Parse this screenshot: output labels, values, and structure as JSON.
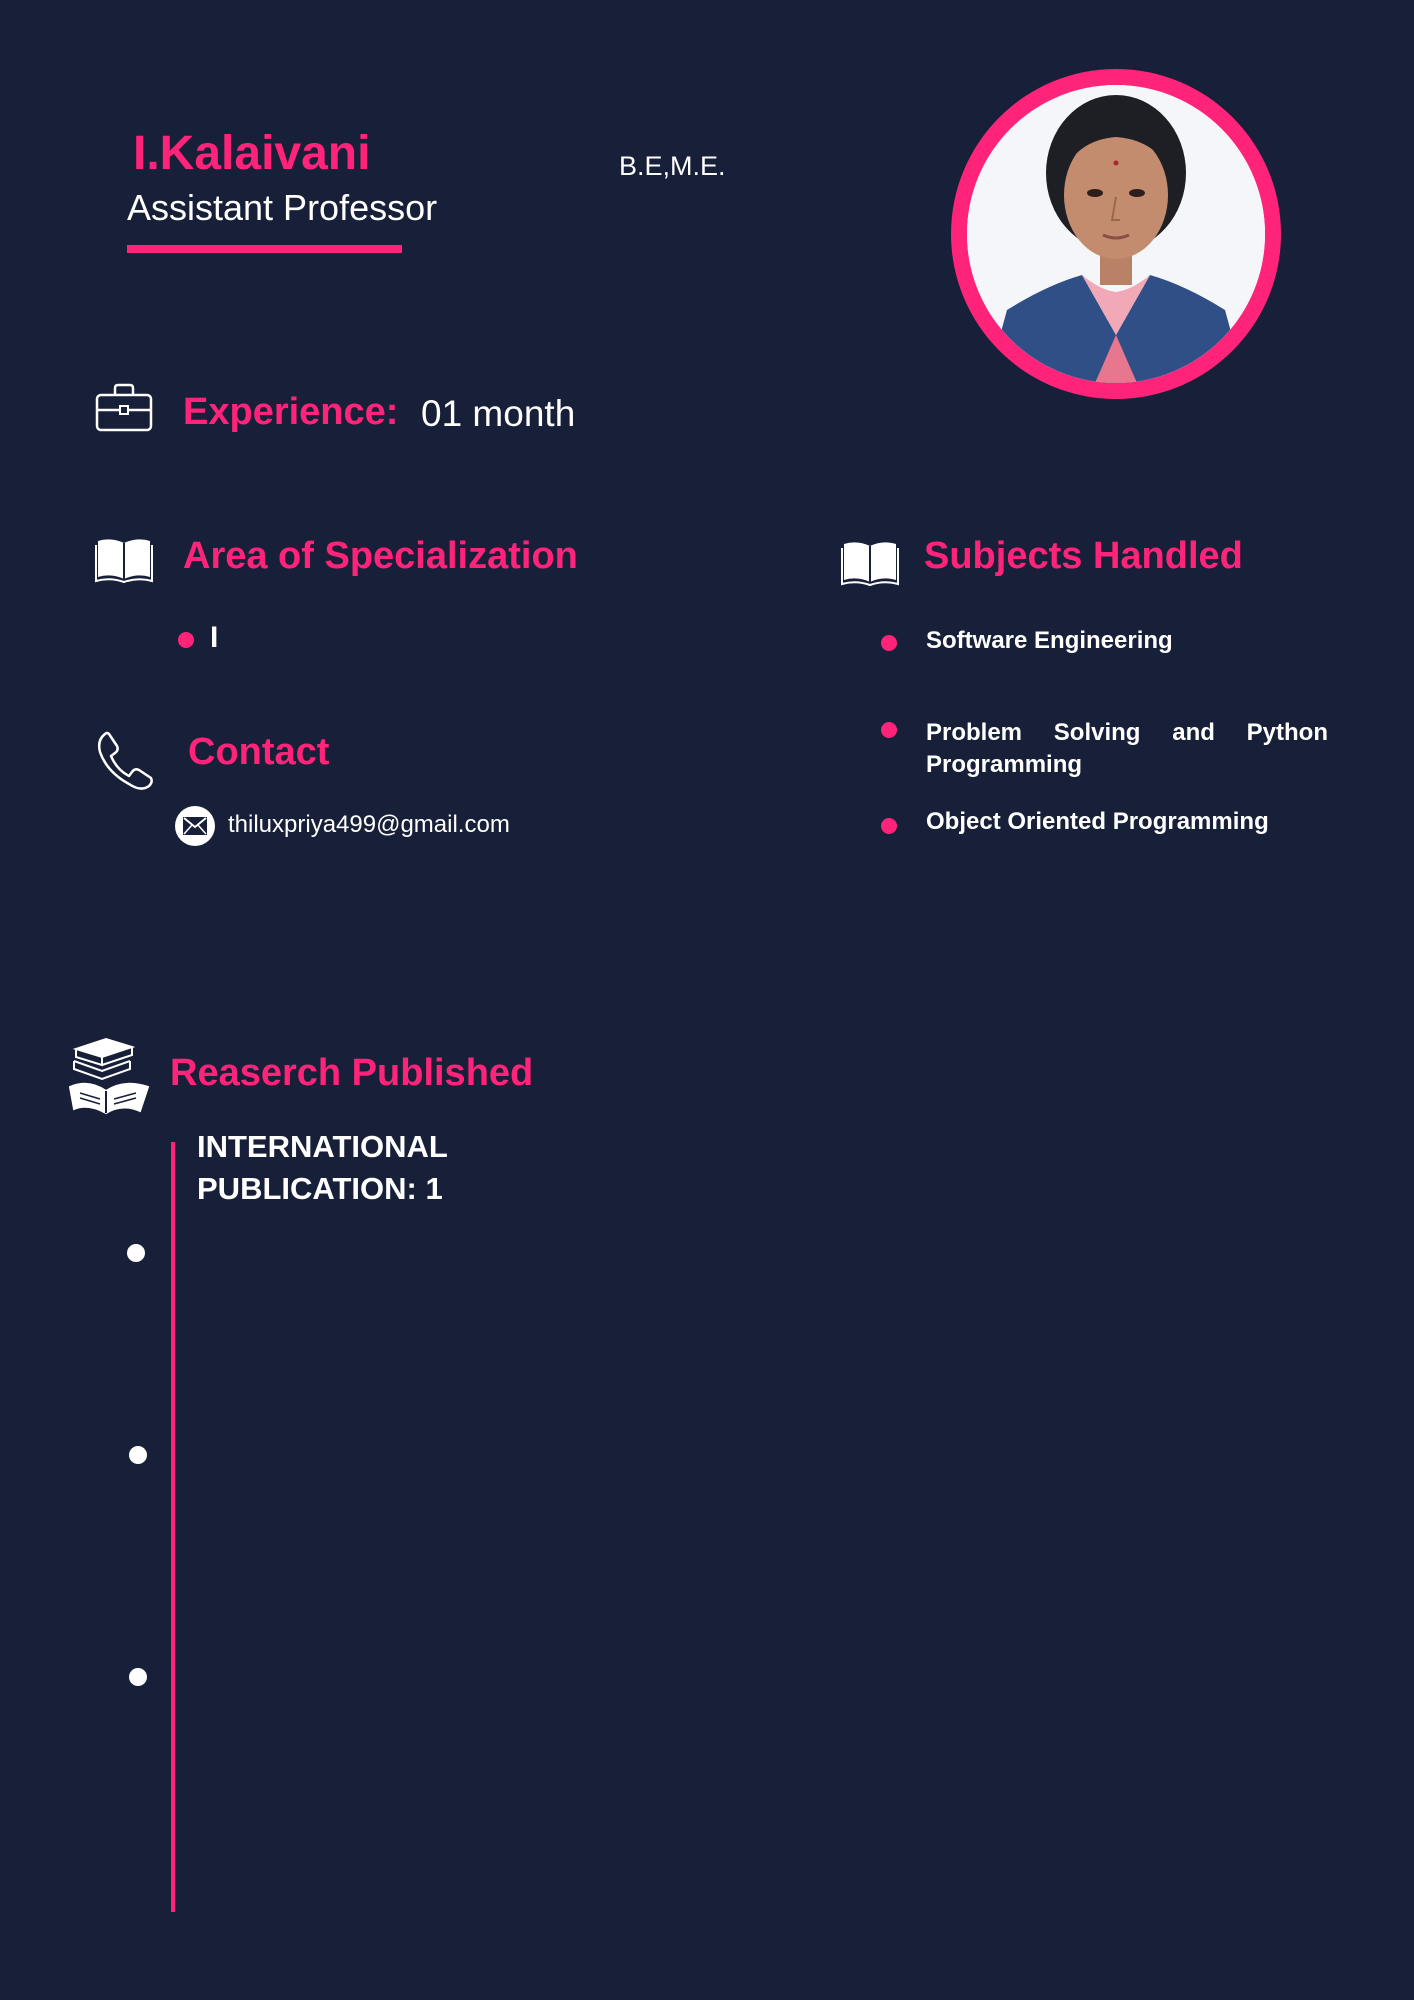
{
  "profile": {
    "name": "I.Kalaivani",
    "title": "Assistant Professor",
    "degree": "B.E,M.E."
  },
  "experience": {
    "label": "Experience:",
    "value": "01 month"
  },
  "specialization": {
    "title": "Area of Specialization",
    "items": [
      "I"
    ]
  },
  "subjects": {
    "title": "Subjects Handled",
    "items": [
      "Software Engineering",
      "Problem Solving and Python Programming",
      "Object Oriented Programming"
    ]
  },
  "contact": {
    "title": "Contact",
    "email": "thiluxpriya499@gmail.com"
  },
  "research": {
    "title": "Reaserch Published",
    "items": [
      "INTERNATIONAL PUBLICATION:  1"
    ]
  },
  "colors": {
    "background": "#172038",
    "accent": "#ff2479",
    "text": "#ffffff"
  },
  "icons": [
    "briefcase-icon",
    "open-book-icon",
    "phone-icon",
    "mail-icon",
    "books-stack-icon"
  ]
}
